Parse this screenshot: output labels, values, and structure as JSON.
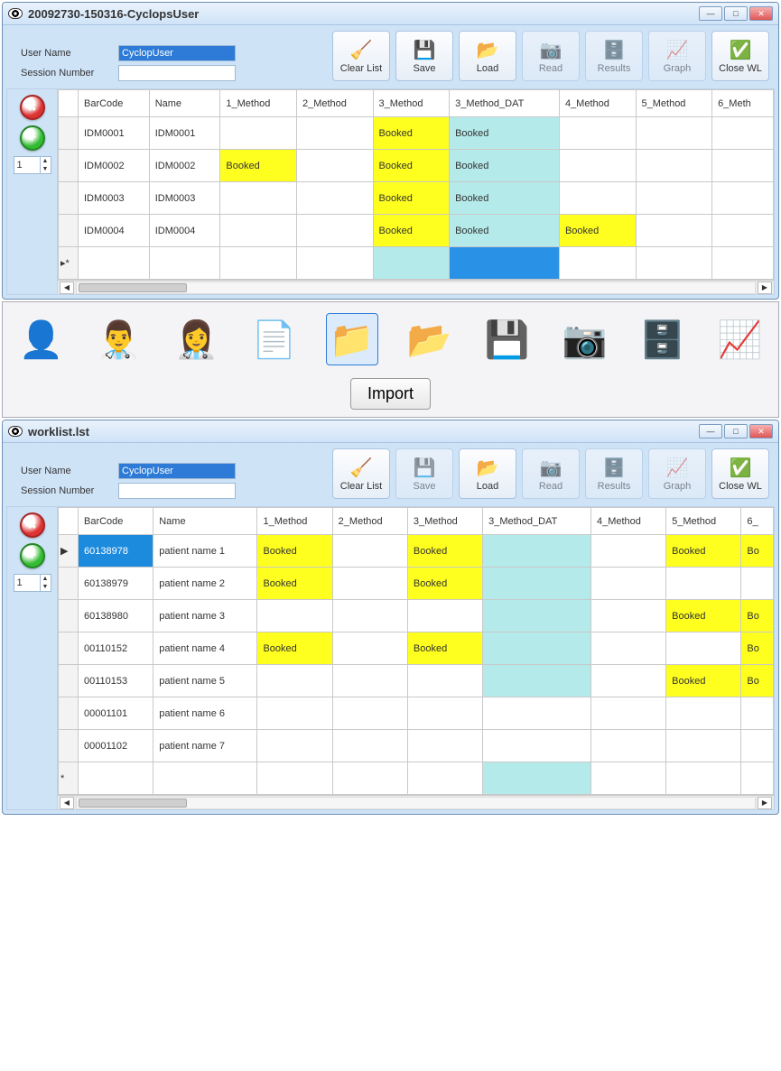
{
  "window1": {
    "title": "20092730-150316-CyclopsUser",
    "userNameLabel": "User Name",
    "userNameValue": "CyclopUser",
    "sessionLabel": "Session Number",
    "sessionValue": "",
    "toolbar": {
      "clear": "Clear List",
      "save": "Save",
      "load": "Load",
      "read": "Read",
      "results": "Results",
      "graph": "Graph",
      "close": "Close WL"
    },
    "spinner": "1",
    "columns": [
      "BarCode",
      "Name",
      "1_Method",
      "2_Method",
      "3_Method",
      "3_Method_DAT",
      "4_Method",
      "5_Method",
      "6_Meth"
    ],
    "rows": [
      {
        "marker": "",
        "barcode": "IDM0001",
        "name": "IDM0001",
        "c1": "",
        "c2": "",
        "c3": {
          "v": "Booked",
          "cls": "cell-yellow"
        },
        "c3d": {
          "v": "Booked",
          "cls": "cell-teal"
        },
        "c4": "",
        "c5": "",
        "c6": ""
      },
      {
        "marker": "",
        "barcode": "IDM0002",
        "name": "IDM0002",
        "c1": {
          "v": "Booked",
          "cls": "cell-yellow"
        },
        "c2": "",
        "c3": {
          "v": "Booked",
          "cls": "cell-yellow"
        },
        "c3d": {
          "v": "Booked",
          "cls": "cell-teal"
        },
        "c4": "",
        "c5": "",
        "c6": ""
      },
      {
        "marker": "",
        "barcode": "IDM0003",
        "name": "IDM0003",
        "c1": "",
        "c2": "",
        "c3": {
          "v": "Booked",
          "cls": "cell-yellow"
        },
        "c3d": {
          "v": "Booked",
          "cls": "cell-teal"
        },
        "c4": "",
        "c5": "",
        "c6": ""
      },
      {
        "marker": "",
        "barcode": "IDM0004",
        "name": "IDM0004",
        "c1": "",
        "c2": "",
        "c3": {
          "v": "Booked",
          "cls": "cell-yellow"
        },
        "c3d": {
          "v": "Booked",
          "cls": "cell-teal"
        },
        "c4": {
          "v": "Booked",
          "cls": "cell-yellow"
        },
        "c5": "",
        "c6": ""
      },
      {
        "marker": "▸*",
        "barcode": "",
        "name": "",
        "c1": "",
        "c2": "",
        "c3": {
          "v": "",
          "cls": "cell-teal"
        },
        "c3d": {
          "v": "",
          "cls": "cell-mblue"
        },
        "c4": "",
        "c5": "",
        "c6": ""
      }
    ]
  },
  "strip": {
    "importLabel": "Import"
  },
  "window2": {
    "title": "worklist.lst",
    "userNameLabel": "User Name",
    "userNameValue": "CyclopUser",
    "sessionLabel": "Session Number",
    "sessionValue": "",
    "toolbar": {
      "clear": "Clear List",
      "save": "Save",
      "load": "Load",
      "read": "Read",
      "results": "Results",
      "graph": "Graph",
      "close": "Close WL"
    },
    "spinner": "1",
    "columns": [
      "BarCode",
      "Name",
      "1_Method",
      "2_Method",
      "3_Method",
      "3_Method_DAT",
      "4_Method",
      "5_Method",
      "6_"
    ],
    "rows": [
      {
        "marker": "▶",
        "barcode": {
          "v": "60138978",
          "cls": "cell-sel"
        },
        "name": "patient name 1",
        "c1": {
          "v": "Booked",
          "cls": "cell-yellow"
        },
        "c2": "",
        "c3": {
          "v": "Booked",
          "cls": "cell-yellow"
        },
        "c3d": {
          "v": "",
          "cls": "cell-teal"
        },
        "c4": "",
        "c5": {
          "v": "Booked",
          "cls": "cell-yellow"
        },
        "c6": {
          "v": "Bo",
          "cls": "cell-yellow"
        }
      },
      {
        "marker": "",
        "barcode": "60138979",
        "name": "patient name 2",
        "c1": {
          "v": "Booked",
          "cls": "cell-yellow"
        },
        "c2": "",
        "c3": {
          "v": "Booked",
          "cls": "cell-yellow"
        },
        "c3d": {
          "v": "",
          "cls": "cell-teal"
        },
        "c4": "",
        "c5": "",
        "c6": ""
      },
      {
        "marker": "",
        "barcode": "60138980",
        "name": "patient name 3",
        "c1": "",
        "c2": "",
        "c3": "",
        "c3d": {
          "v": "",
          "cls": "cell-teal"
        },
        "c4": "",
        "c5": {
          "v": "Booked",
          "cls": "cell-yellow"
        },
        "c6": {
          "v": "Bo",
          "cls": "cell-yellow"
        }
      },
      {
        "marker": "",
        "barcode": "00110152",
        "name": "patient name 4",
        "c1": {
          "v": "Booked",
          "cls": "cell-yellow"
        },
        "c2": "",
        "c3": {
          "v": "Booked",
          "cls": "cell-yellow"
        },
        "c3d": {
          "v": "",
          "cls": "cell-teal"
        },
        "c4": "",
        "c5": "",
        "c6": {
          "v": "Bo",
          "cls": "cell-yellow"
        }
      },
      {
        "marker": "",
        "barcode": "00110153",
        "name": "patient name 5",
        "c1": "",
        "c2": "",
        "c3": "",
        "c3d": {
          "v": "",
          "cls": "cell-teal"
        },
        "c4": "",
        "c5": {
          "v": "Booked",
          "cls": "cell-yellow"
        },
        "c6": {
          "v": "Bo",
          "cls": "cell-yellow"
        }
      },
      {
        "marker": "",
        "barcode": "00001101",
        "name": "patient name 6",
        "c1": "",
        "c2": "",
        "c3": "",
        "c3d": "",
        "c4": "",
        "c5": "",
        "c6": ""
      },
      {
        "marker": "",
        "barcode": "00001102",
        "name": "patient name 7",
        "c1": "",
        "c2": "",
        "c3": "",
        "c3d": "",
        "c4": "",
        "c5": "",
        "c6": ""
      },
      {
        "marker": "*",
        "barcode": "",
        "name": "",
        "c1": "",
        "c2": "",
        "c3": "",
        "c3d": {
          "v": "",
          "cls": "cell-teal"
        },
        "c4": "",
        "c5": "",
        "c6": ""
      }
    ]
  }
}
